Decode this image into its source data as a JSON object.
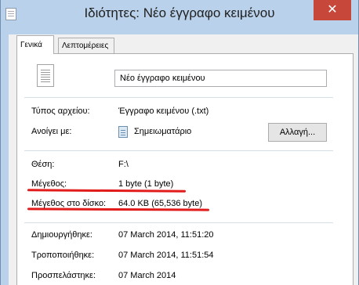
{
  "window": {
    "title": "Ιδιότητες: Νέο έγγραφο κειμένου",
    "close_glyph": "✕"
  },
  "tabs": [
    {
      "label": "Γενικά",
      "active": true
    },
    {
      "label": "Λεπτομέρειες",
      "active": false
    }
  ],
  "file": {
    "name": "Νέο έγγραφο κειμένου"
  },
  "props": {
    "type_label": "Τύπος αρχείου:",
    "type_value": "Έγγραφο κειμένου (.txt)",
    "opens_label": "Ανοίγει με:",
    "opens_value": "Σημειωματάριο",
    "change_button": "Αλλαγή...",
    "location_label": "Θέση:",
    "location_value": "F:\\",
    "size_label": "Μέγεθος:",
    "size_value": "1 byte (1 byte)",
    "disk_label": "Μέγεθος στο δίσκο:",
    "disk_value": "64.0 KB (65,536 byte)",
    "created_label": "Δημιουργήθηκε:",
    "created_value": "07 March 2014, 11:51:20",
    "modified_label": "Τροποποιήθηκε:",
    "modified_value": "07 March 2014, 11:51:54",
    "accessed_label": "Προσπελάστηκε:",
    "accessed_value": "07 March 2014"
  },
  "colors": {
    "annotation_underline": "#e21b1b",
    "title_bar": "#b9d1ea",
    "close_button": "#c7473a"
  },
  "icons": {
    "window": "text-file-icon",
    "file": "text-document-icon",
    "program": "notepad-icon"
  }
}
